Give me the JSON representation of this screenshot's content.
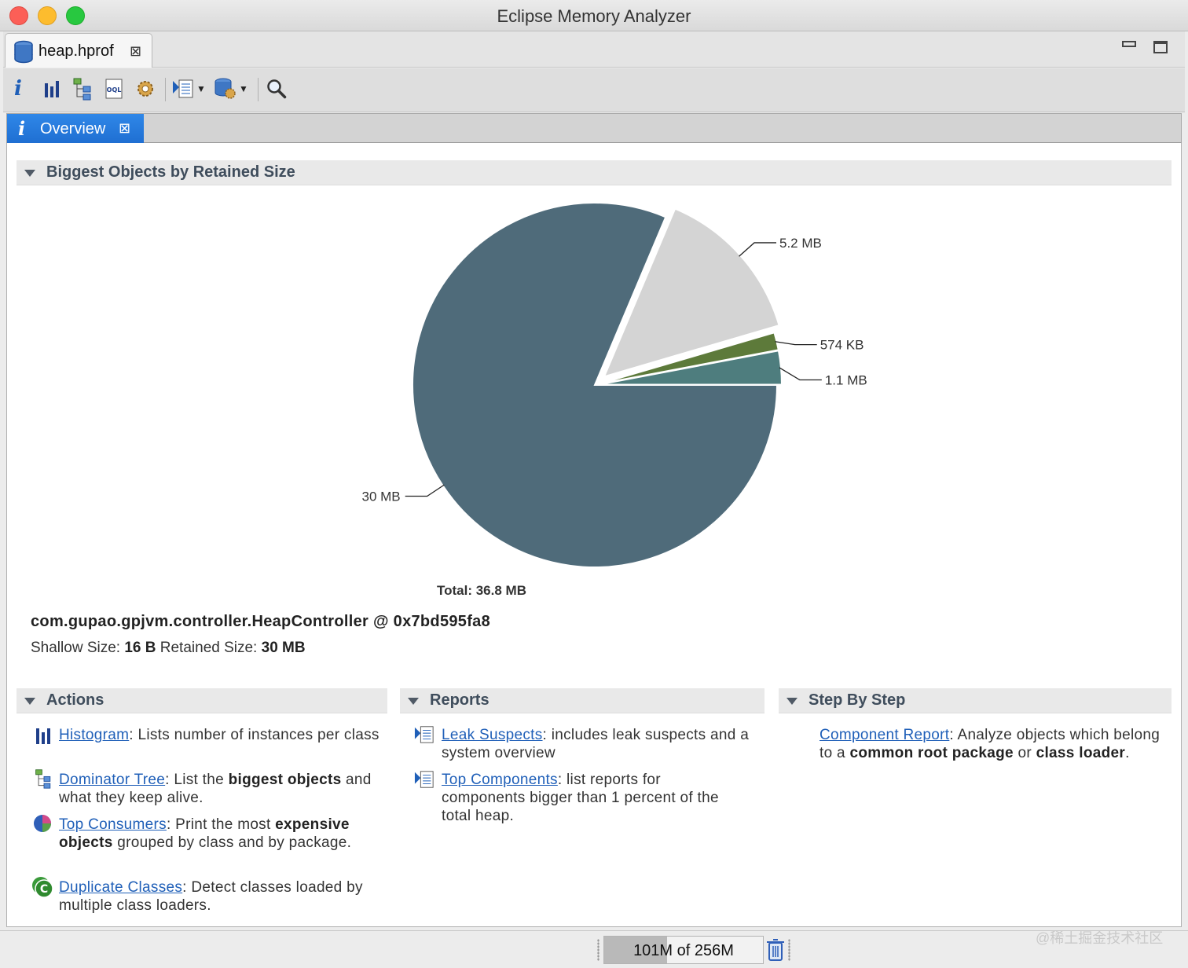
{
  "window": {
    "title": "Eclipse Memory Analyzer"
  },
  "editor_tab": {
    "label": "heap.hprof",
    "close_glyph": "⊠"
  },
  "toolbar": {
    "buttons": [
      {
        "name": "overview-info",
        "icon": "info-icon"
      },
      {
        "name": "histogram",
        "icon": "histogram-icon"
      },
      {
        "name": "dominator-tree",
        "icon": "dominator-tree-icon"
      },
      {
        "name": "oql",
        "icon": "oql-icon"
      },
      {
        "name": "thread-overview",
        "icon": "gear-icon"
      },
      {
        "name": "run-report",
        "icon": "report-icon",
        "dropdown": true
      },
      {
        "name": "query-browser",
        "icon": "query-browser-icon",
        "dropdown": true
      },
      {
        "name": "find-object",
        "icon": "search-icon"
      }
    ]
  },
  "view_tab": {
    "label": "Overview",
    "close_glyph": "⊠"
  },
  "biggest_objects": {
    "title": "Biggest Objects by Retained Size"
  },
  "chart_data": {
    "type": "pie",
    "unit": "MB",
    "slices": [
      {
        "label": "30 MB",
        "value": 30.0,
        "color": "#4f6b7a"
      },
      {
        "label": "5.2 MB",
        "value": 5.2,
        "color": "#d4d4d4",
        "exploded": true
      },
      {
        "label": "574 KB",
        "value": 0.574,
        "color": "#5d7a3a"
      },
      {
        "label": "1.1 MB",
        "value": 1.1,
        "color": "#4e7d7e"
      }
    ],
    "total_label": "Total: 36.8 MB"
  },
  "selected_object": {
    "name": "com.gupao.gpjvm.controller.HeapController @ 0x7bd595fa8",
    "shallow_label": "Shallow Size:",
    "shallow_value": "16 B",
    "retained_label": "Retained Size:",
    "retained_value": "30 MB"
  },
  "actions": {
    "title": "Actions",
    "items": [
      {
        "link": "Histogram",
        "sep": ":",
        "text": "Lists number of instances per class",
        "icon": "histogram-icon"
      },
      {
        "link": "Dominator Tree",
        "sep": ":",
        "t1": "List the",
        "b1": "biggest objects",
        "t2": "and what they keep alive.",
        "icon": "dominator-tree-icon"
      },
      {
        "link": "Top Consumers",
        "sep": ":",
        "t1": "Print the most",
        "b1": "expensive objects",
        "t2": "grouped by class and by package.",
        "icon": "pie-chart-icon"
      },
      {
        "link": "Duplicate Classes",
        "sep": ":",
        "text": "Detect classes loaded by multiple class loaders.",
        "icon": "duplicate-classes-icon"
      }
    ]
  },
  "reports": {
    "title": "Reports",
    "items": [
      {
        "link": "Leak Suspects",
        "sep": ":",
        "text": "includes leak suspects and a system overview",
        "icon": "report-icon"
      },
      {
        "link": "Top Components",
        "sep": ":",
        "text": "list reports for components bigger than 1 percent of the total heap.",
        "icon": "report-icon"
      }
    ]
  },
  "step_by_step": {
    "title": "Step By Step",
    "items": [
      {
        "link": "Component Report",
        "sep": ":",
        "t1": "Analyze objects which belong to a",
        "b1": "common root package",
        "t2": "or",
        "b2": "class loader",
        "t3": "."
      }
    ]
  },
  "status": {
    "heap_text": "101M of 256M",
    "heap_used_fraction": 0.395
  },
  "watermark": "@稀土掘金技术社区"
}
